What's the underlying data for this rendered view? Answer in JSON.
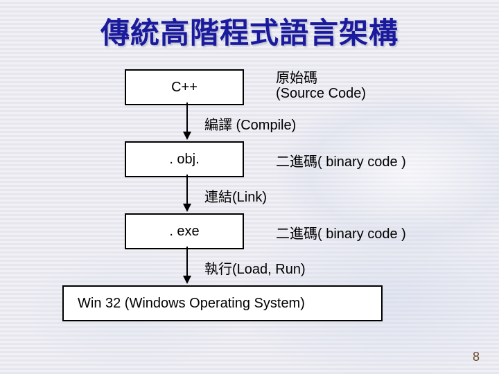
{
  "title": "傳統高階程式語言架構",
  "boxes": {
    "cpp": "C++",
    "obj": ". obj.",
    "exe": ". exe",
    "win32": "Win 32 (Windows Operating System)"
  },
  "labels": {
    "source_code": "原始碼\n(Source Code)",
    "binary_code_1": "二進碼( binary code )",
    "binary_code_2": "二進碼( binary code )"
  },
  "steps": {
    "compile": "編譯 (Compile)",
    "link": "連結(Link)",
    "run": "執行(Load, Run)"
  },
  "page_number": "8"
}
